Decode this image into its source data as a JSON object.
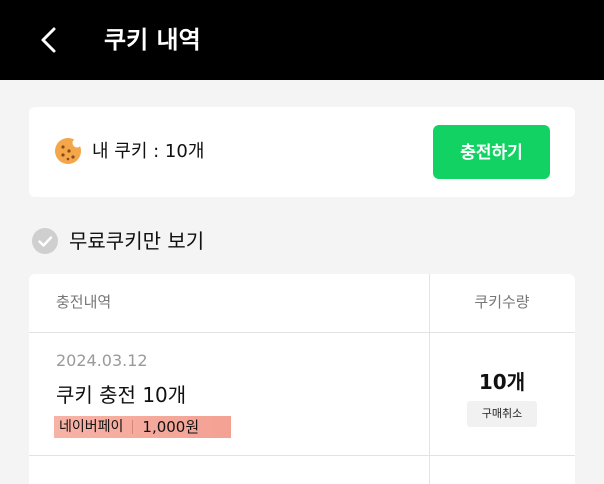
{
  "header": {
    "title": "쿠키 내역",
    "back_icon": "chevron-left-icon"
  },
  "balance": {
    "icon": "cookie-icon",
    "label": "내 쿠키 : 10개",
    "charge_label": "충전하기",
    "charge_color": "#12d263"
  },
  "filter": {
    "label": "무료쿠키만 보기",
    "checked": false,
    "icon": "check-circle-icon"
  },
  "table": {
    "headers": {
      "history": "충전내역",
      "quantity": "쿠키수량"
    },
    "rows": [
      {
        "date": "2024.03.12",
        "title": "쿠키 충전 10개",
        "payment_method": "네이버페이",
        "amount": "1,000원",
        "quantity": "10개",
        "cancel_label": "구매취소"
      }
    ]
  }
}
